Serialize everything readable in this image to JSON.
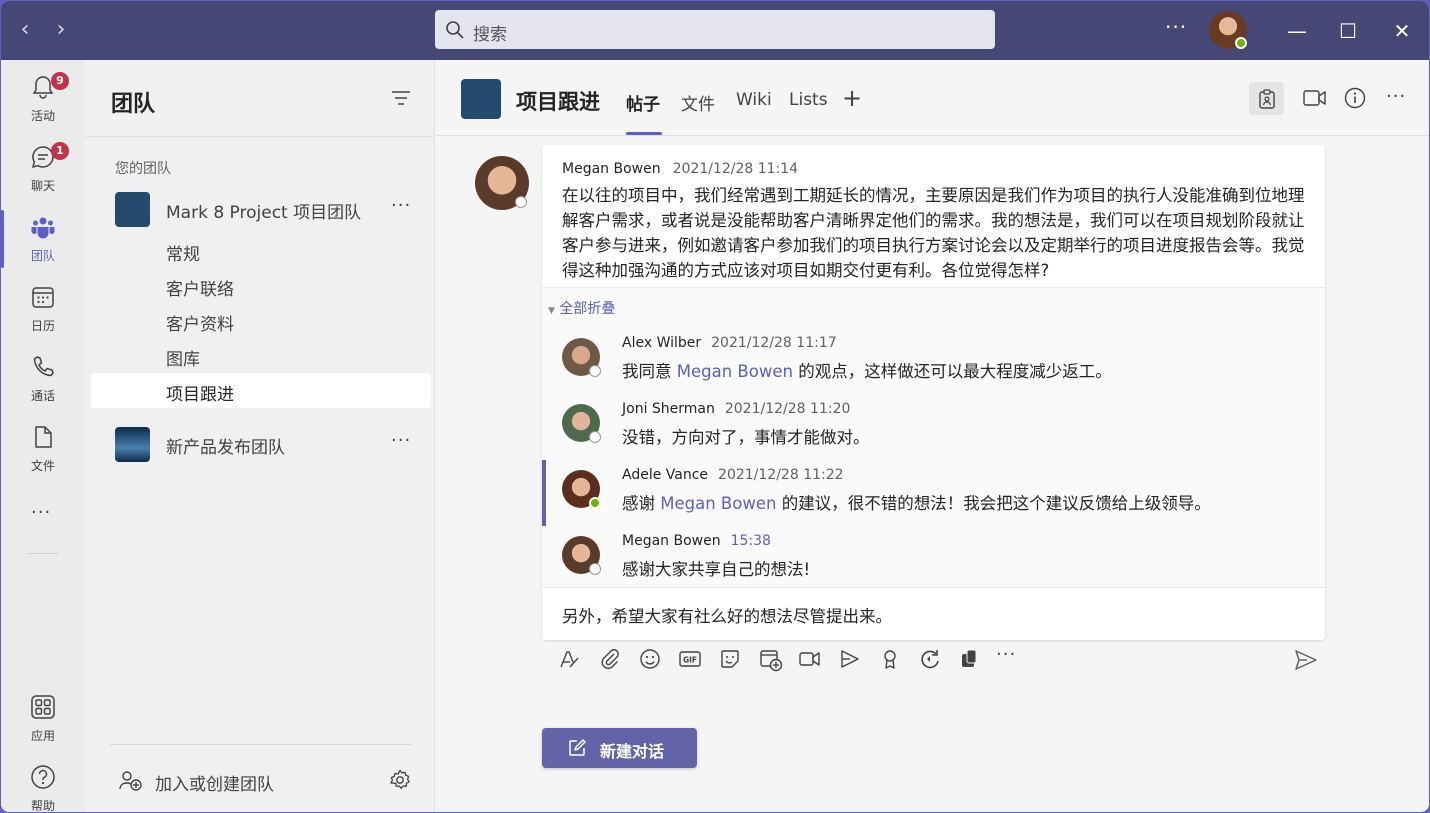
{
  "titlebar": {
    "search_placeholder": "搜索",
    "more_label": "···",
    "minimize": "—",
    "maximize": "☐",
    "close": "✕",
    "back": "‹",
    "forward": "›"
  },
  "rail": {
    "items": [
      {
        "label": "活动",
        "badge": "9",
        "icon": "bell-icon"
      },
      {
        "label": "聊天",
        "badge": "1",
        "icon": "chat-icon"
      },
      {
        "label": "团队",
        "icon": "teams-icon",
        "active": true
      },
      {
        "label": "日历",
        "icon": "calendar-icon"
      },
      {
        "label": "通话",
        "icon": "phone-icon"
      },
      {
        "label": "文件",
        "icon": "file-icon"
      }
    ],
    "more": "···",
    "apps_label": "应用",
    "help_label": "帮助"
  },
  "teams_panel": {
    "title": "团队",
    "section_label": "您的团队",
    "teams": [
      {
        "name": "Mark 8 Project 项目团队",
        "channels": [
          "常规",
          "客户联络",
          "客户资料",
          "图库",
          "项目跟进"
        ]
      },
      {
        "name": "新产品发布团队",
        "channels": []
      }
    ],
    "active_channel": "项目跟进",
    "join_label": "加入或创建团队"
  },
  "channel": {
    "title": "项目跟进",
    "tabs": [
      "帖子",
      "文件",
      "Wiki",
      "Lists"
    ],
    "active_tab": "帖子",
    "add_tab": "+"
  },
  "post": {
    "author": "Megan Bowen",
    "time": "2021/12/28 11:14",
    "body": "在以往的项目中，我们经常遇到工期延长的情况，主要原因是我们作为项目的执行人没能准确到位地理解客户需求，或者说是没能帮助客户清晰界定他们的需求。我的想法是，我们可以在项目规划阶段就让客户参与进来，例如邀请客户参加我们的项目执行方案讨论会以及定期举行的项目进度报告会等。我觉得这种加强沟通的方式应该对项目如期交付更有利。各位觉得怎样?",
    "collapse_label": "全部折叠",
    "replies": [
      {
        "author": "Alex Wilber",
        "time": "2021/12/28 11:17",
        "pre": "我同意 ",
        "mention": "Megan Bowen",
        "post": " 的观点，这样做还可以最大程度减少返工。"
      },
      {
        "author": "Joni Sherman",
        "time": "2021/12/28 11:20",
        "pre": "没错，方向对了，事情才能做对。",
        "mention": "",
        "post": ""
      },
      {
        "author": "Adele Vance",
        "time": "2021/12/28 11:22",
        "pre": "感谢 ",
        "mention": "Megan Bowen",
        "post": " 的建议，很不错的想法！我会把这个建议反馈给上级领导。"
      },
      {
        "author": "Megan Bowen",
        "time": "15:38",
        "pre": "感谢大家共享自己的想法!",
        "mention": "",
        "post": ""
      }
    ],
    "compose_text": "另外，希望大家有社么好的想法尽管提出来。"
  },
  "new_conversation_label": "新建对话",
  "colors": {
    "accent": "#5b5fc7",
    "titlebar": "#464775",
    "badge": "#c4314b",
    "presence_available": "#6bb700"
  }
}
